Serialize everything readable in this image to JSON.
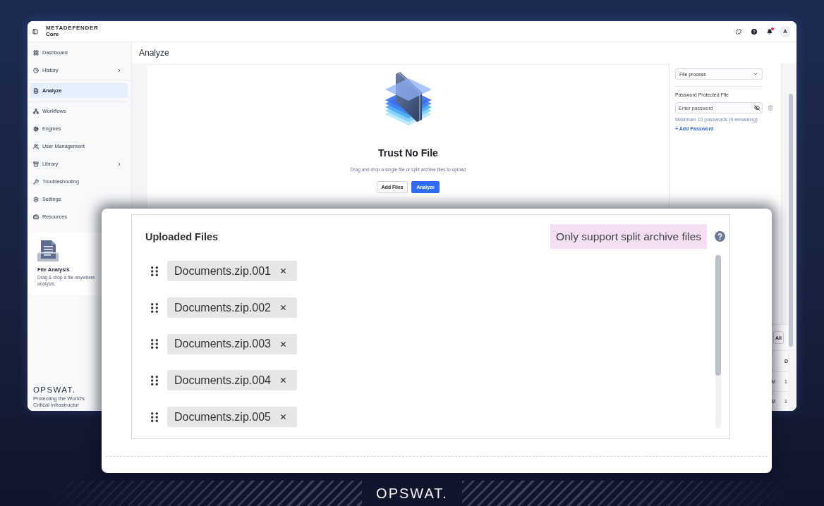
{
  "app_window": {
    "brand": {
      "product_line": "METADEFENDER",
      "product": "Core"
    },
    "topbar": {
      "notifications_unread": true,
      "avatar_initial": "A"
    },
    "sidebar": {
      "groups": [
        {
          "items": [
            {
              "label": "Dashboard",
              "selected": false,
              "submenu": false
            },
            {
              "label": "History",
              "selected": false,
              "submenu": true
            }
          ]
        },
        {
          "items": [
            {
              "label": "Analyze",
              "selected": true,
              "submenu": false
            }
          ]
        },
        {
          "items": [
            {
              "label": "Workflows",
              "selected": false,
              "submenu": false
            },
            {
              "label": "Engines",
              "selected": false,
              "submenu": false
            },
            {
              "label": "User Management",
              "selected": false,
              "submenu": false
            },
            {
              "label": "Library",
              "selected": false,
              "submenu": true
            },
            {
              "label": "Troubleshooting",
              "selected": false,
              "submenu": false
            },
            {
              "label": "Settings",
              "selected": false,
              "submenu": false
            },
            {
              "label": "Resources",
              "selected": false,
              "submenu": false
            }
          ]
        }
      ],
      "promo_card": {
        "title": "File Analysis",
        "description_lines": [
          "Drag & drop a file anywhere",
          "analysis."
        ]
      },
      "logo": "OPSWAT.",
      "tagline": "Protecting the World's Critical Infrastructur"
    },
    "page_title": "Analyze",
    "upload_card": {
      "title": "Trust No File",
      "subtitle": "Drag and drop a single file or split archive files to upload",
      "buttons": [
        {
          "label": "Add Files",
          "kind": "secondary"
        },
        {
          "label": "Analyze",
          "kind": "primary"
        }
      ]
    },
    "options_panel": {
      "process_select": {
        "value": "File process"
      },
      "password": {
        "label": "Password Protected File",
        "placeholder": "Enter password",
        "hint": "Maximum 10 passwords (9 remaining)",
        "add_link": "+ Add Password"
      }
    },
    "recent_section": {
      "button": "All",
      "table": {
        "header_column_2": "D",
        "rows": [
          {
            "column_1": "M",
            "column_2": "1"
          },
          {
            "column_1": "M",
            "column_2": "1"
          }
        ]
      }
    }
  },
  "uploaded_files": {
    "title": "Uploaded Files",
    "notice": "Only support split archive files",
    "files": [
      {
        "name": "Documents.zip.001"
      },
      {
        "name": "Documents.zip.002"
      },
      {
        "name": "Documents.zip.003"
      },
      {
        "name": "Documents.zip.004"
      },
      {
        "name": "Documents.zip.005"
      }
    ]
  },
  "footer_logo": "OPSWAT."
}
